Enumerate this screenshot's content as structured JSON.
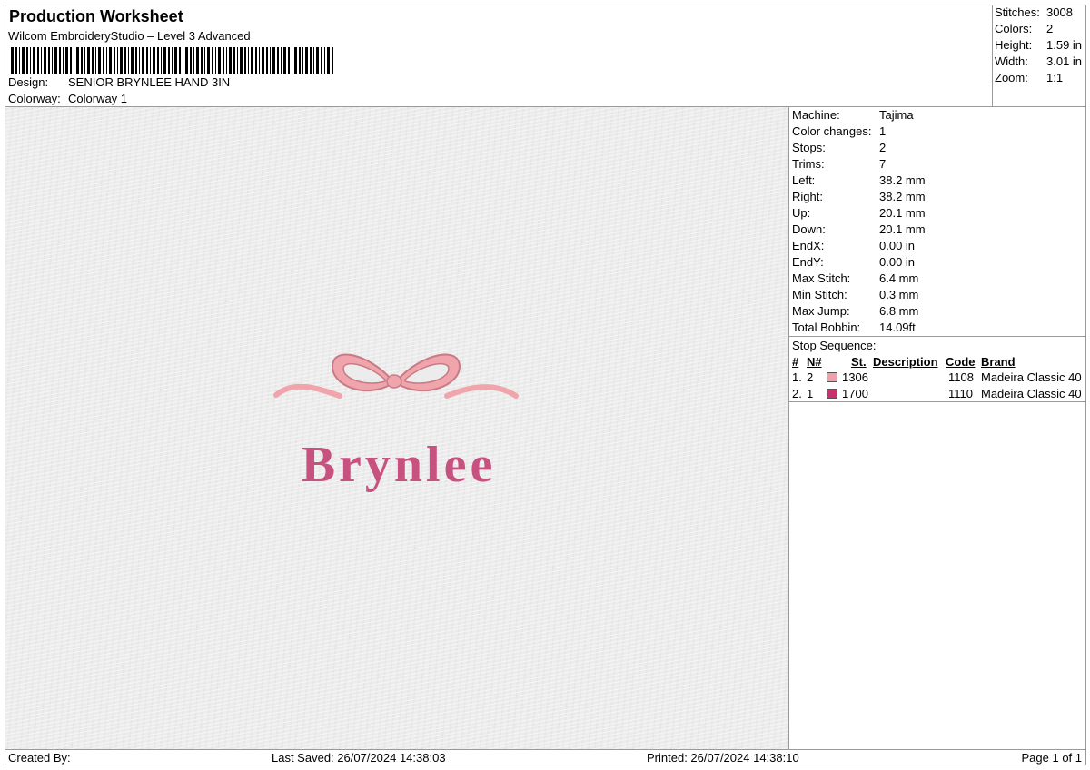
{
  "header": {
    "title": "Production Worksheet",
    "subtitle": "Wilcom EmbroideryStudio – Level 3 Advanced",
    "design_label": "Design:",
    "design_value": "SENIOR BRYNLEE HAND 3IN",
    "colorway_label": "Colorway:",
    "colorway_value": "Colorway 1"
  },
  "summary": {
    "stitches_label": "Stitches:",
    "stitches_value": "3008",
    "colors_label": "Colors:",
    "colors_value": "2",
    "height_label": "Height:",
    "height_value": "1.59 in",
    "width_label": "Width:",
    "width_value": "3.01 in",
    "zoom_label": "Zoom:",
    "zoom_value": "1:1"
  },
  "design": {
    "text": "Brynlee",
    "text_color": "#c8527f",
    "bow_color": "#f0a4ab",
    "bow_outline": "#c97a84"
  },
  "params": [
    {
      "label": "Machine:",
      "value": "Tajima"
    },
    {
      "label": "Color changes:",
      "value": "1"
    },
    {
      "label": "Stops:",
      "value": "2"
    },
    {
      "label": "Trims:",
      "value": "7"
    },
    {
      "label": "Left:",
      "value": "38.2 mm"
    },
    {
      "label": "Right:",
      "value": "38.2 mm"
    },
    {
      "label": "Up:",
      "value": "20.1 mm"
    },
    {
      "label": "Down:",
      "value": "20.1 mm"
    },
    {
      "label": "EndX:",
      "value": "0.00 in"
    },
    {
      "label": "EndY:",
      "value": "0.00 in"
    },
    {
      "label": "Max Stitch:",
      "value": "6.4 mm"
    },
    {
      "label": "Min Stitch:",
      "value": "0.3 mm"
    },
    {
      "label": "Max Jump:",
      "value": "6.8 mm"
    },
    {
      "label": "Total Bobbin:",
      "value": "14.09ft"
    }
  ],
  "stop_sequence": {
    "title": "Stop Sequence:",
    "headers": {
      "num": "#",
      "n": "N#",
      "st": "St.",
      "description": "Description",
      "code": "Code",
      "brand": "Brand"
    },
    "rows": [
      {
        "num": "1.",
        "n": "2",
        "color": "#f0a0aa",
        "st": "1306",
        "description": "",
        "code": "1108",
        "brand": "Madeira Classic 40"
      },
      {
        "num": "2.",
        "n": "1",
        "color": "#c8326e",
        "st": "1700",
        "description": "",
        "code": "1110",
        "brand": "Madeira Classic 40"
      }
    ]
  },
  "footer": {
    "created_by": "Created By:",
    "last_saved": "Last Saved: 26/07/2024 14:38:03",
    "printed": "Printed: 26/07/2024 14:38:10",
    "page": "Page 1 of 1"
  }
}
